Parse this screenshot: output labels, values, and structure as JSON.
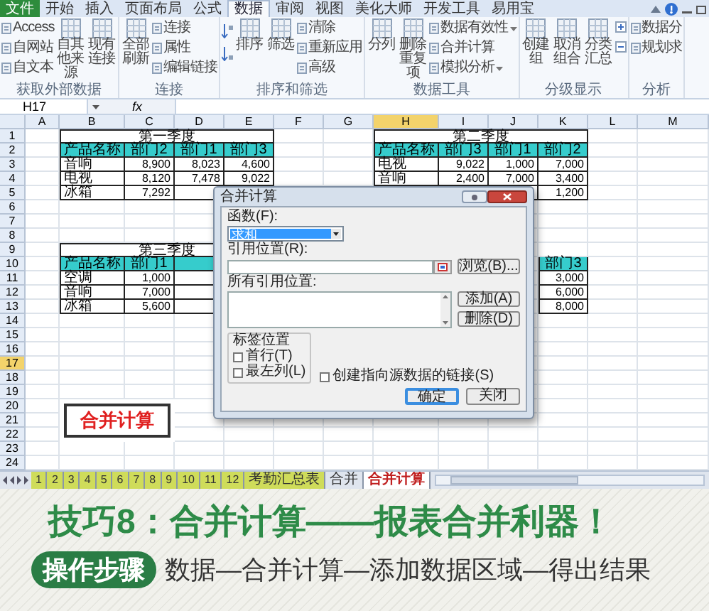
{
  "ribbon_tabs": [
    {
      "label": "文件",
      "kind": "file",
      "selected": false
    },
    {
      "label": "开始",
      "kind": "tab",
      "selected": false
    },
    {
      "label": "插入",
      "kind": "tab",
      "selected": false
    },
    {
      "label": "页面布局",
      "kind": "tab",
      "selected": false
    },
    {
      "label": "公式",
      "kind": "tab",
      "selected": false
    },
    {
      "label": "数据",
      "kind": "tab",
      "selected": true
    },
    {
      "label": "审阅",
      "kind": "tab",
      "selected": false
    },
    {
      "label": "视图",
      "kind": "tab",
      "selected": false
    },
    {
      "label": "美化大师",
      "kind": "tab",
      "selected": false
    },
    {
      "label": "开发工具",
      "kind": "tab",
      "selected": false
    },
    {
      "label": "易用宝",
      "kind": "tab",
      "selected": false
    }
  ],
  "ribbon_groups": [
    {
      "label": "获取外部数据",
      "columns": [
        {
          "kind": "stack",
          "items": [
            {
              "label": "Access"
            },
            {
              "label": "自网站"
            },
            {
              "label": "自文本"
            }
          ]
        },
        {
          "kind": "large",
          "label": "自其他来源"
        },
        {
          "kind": "large",
          "label": "现有连接"
        }
      ]
    },
    {
      "label": "连接",
      "columns": [
        {
          "kind": "large",
          "label": "全部刷新"
        },
        {
          "kind": "stack",
          "items": [
            {
              "label": "连接"
            },
            {
              "label": "属性"
            },
            {
              "label": "编辑链接"
            }
          ]
        }
      ]
    },
    {
      "label": "排序和筛选",
      "columns": [
        {
          "kind": "sort_icons"
        },
        {
          "kind": "large",
          "label": "排序"
        },
        {
          "kind": "large",
          "label": "筛选"
        },
        {
          "kind": "stack",
          "items": [
            {
              "label": "清除"
            },
            {
              "label": "重新应用"
            },
            {
              "label": "高级"
            }
          ]
        }
      ]
    },
    {
      "label": "数据工具",
      "columns": [
        {
          "kind": "large",
          "label": "分列"
        },
        {
          "kind": "large",
          "label": "删除重复项"
        },
        {
          "kind": "stack",
          "items": [
            {
              "label": "数据有效性",
              "has_menu": true
            },
            {
              "label": "合并计算"
            },
            {
              "label": "模拟分析",
              "has_menu": true
            }
          ]
        }
      ]
    },
    {
      "label": "分级显示",
      "columns": [
        {
          "kind": "large",
          "label": "创建组"
        },
        {
          "kind": "large",
          "label": "取消组合"
        },
        {
          "kind": "large",
          "label": "分类汇总"
        },
        {
          "kind": "outline_icons"
        }
      ]
    },
    {
      "label": "分析",
      "columns": [
        {
          "kind": "stack",
          "items": [
            {
              "label": "数据分"
            },
            {
              "label": "规划求"
            }
          ]
        }
      ]
    }
  ],
  "formula_bar": {
    "name_box": "H17",
    "function_button": "fx"
  },
  "sheet": {
    "columns": [
      {
        "label": "A",
        "selected": false
      },
      {
        "label": "B",
        "selected": false
      },
      {
        "label": "C",
        "selected": false
      },
      {
        "label": "D",
        "selected": false
      },
      {
        "label": "E",
        "selected": false
      },
      {
        "label": "F",
        "selected": false
      },
      {
        "label": "G",
        "selected": false
      },
      {
        "label": "H",
        "selected": true
      },
      {
        "label": "I",
        "selected": false
      },
      {
        "label": "J",
        "selected": false
      },
      {
        "label": "K",
        "selected": false
      },
      {
        "label": "L",
        "selected": false
      },
      {
        "label": "M",
        "selected": false
      }
    ],
    "rows": [
      {
        "label": "1",
        "selected": false
      },
      {
        "label": "2",
        "selected": false
      },
      {
        "label": "3",
        "selected": false
      },
      {
        "label": "4",
        "selected": false
      },
      {
        "label": "5",
        "selected": false
      },
      {
        "label": "6",
        "selected": false
      },
      {
        "label": "7",
        "selected": false
      },
      {
        "label": "8",
        "selected": false
      },
      {
        "label": "9",
        "selected": false
      },
      {
        "label": "10",
        "selected": false
      },
      {
        "label": "11",
        "selected": false
      },
      {
        "label": "12",
        "selected": false
      },
      {
        "label": "13",
        "selected": false
      },
      {
        "label": "14",
        "selected": false
      },
      {
        "label": "15",
        "selected": false
      },
      {
        "label": "16",
        "selected": false
      },
      {
        "label": "17",
        "selected": true
      },
      {
        "label": "18",
        "selected": false
      },
      {
        "label": "19",
        "selected": false
      },
      {
        "label": "20",
        "selected": false
      },
      {
        "label": "21",
        "selected": false
      },
      {
        "label": "22",
        "selected": false
      },
      {
        "label": "23",
        "selected": false
      },
      {
        "label": "24",
        "selected": false
      }
    ],
    "tables": [
      {
        "title": "第一季度",
        "header": [
          "产品名称",
          "部门2",
          "部门1",
          "部门3"
        ],
        "rows": [
          [
            "音响",
            "8,900",
            "8,023",
            "4,600"
          ],
          [
            "电视",
            "8,120",
            "7,478",
            "9,022"
          ],
          [
            "冰箱",
            "7,292"
          ]
        ]
      },
      {
        "title": "第二季度",
        "header": [
          "产品名称",
          "部门3",
          "部门1",
          "部门2"
        ],
        "rows": [
          [
            "电视",
            "9,022",
            "1,000",
            "7,000"
          ],
          [
            "音响",
            "2,400",
            "7,000",
            "3,400"
          ],
          [
            "",
            "",
            "",
            "1,200"
          ]
        ]
      },
      {
        "title": "第三季度",
        "header": [
          "产品名称",
          "部门1"
        ],
        "rows": [
          [
            "空调",
            "1,000"
          ],
          [
            "音响",
            "7,000"
          ],
          [
            "冰箱",
            "5,600"
          ]
        ]
      },
      {
        "header": [
          "部门3"
        ],
        "rows": [
          [
            "3,000"
          ],
          [
            "6,000"
          ],
          [
            "8,000"
          ]
        ]
      }
    ],
    "label_box": {
      "text": "合并计算"
    },
    "sheet_tabs": [
      {
        "label": "1",
        "selected": false,
        "color": "#cfdc5a"
      },
      {
        "label": "2",
        "selected": false,
        "color": "#cfdc5a"
      },
      {
        "label": "3",
        "selected": false,
        "color": "#cfdc5a"
      },
      {
        "label": "4",
        "selected": false,
        "color": "#cfdc5a"
      },
      {
        "label": "5",
        "selected": false,
        "color": "#cfdc5a"
      },
      {
        "label": "6",
        "selected": false,
        "color": "#cfdc5a"
      },
      {
        "label": "7",
        "selected": false,
        "color": "#cfdc5a"
      },
      {
        "label": "8",
        "selected": false,
        "color": "#cfdc5a"
      },
      {
        "label": "9",
        "selected": false,
        "color": "#cfdc5a"
      },
      {
        "label": "10",
        "selected": false,
        "color": "#cfdc5a"
      },
      {
        "label": "11",
        "selected": false,
        "color": "#cfdc5a"
      },
      {
        "label": "12",
        "selected": false,
        "color": "#cfdc5a"
      },
      {
        "label": "考勤汇总表",
        "selected": false,
        "color": "#cfdc5a"
      },
      {
        "label": "合并",
        "selected": false
      },
      {
        "label": "合并计算",
        "selected": true
      }
    ]
  },
  "dialog": {
    "title": "合并计算",
    "function_label": "函数(F):",
    "function_value": "求和",
    "reference_label": "引用位置(R):",
    "browse_button": "浏览(B)...",
    "all_references_label": "所有引用位置:",
    "add_button": "添加(A)",
    "delete_button": "删除(D)",
    "label_position": {
      "title": "标签位置",
      "options": [
        {
          "label": "首行(T)",
          "checked": false
        },
        {
          "label": "最左列(L)",
          "checked": false
        }
      ]
    },
    "link_option": {
      "label": "创建指向源数据的链接(S)",
      "checked": false
    },
    "buttons": [
      {
        "label": "确定",
        "default": true
      },
      {
        "label": "关闭",
        "default": false
      }
    ]
  },
  "banner": {
    "title": "技巧8：合并计算——报表合并利器！",
    "step_badge": "操作步骤",
    "steps": "数据—合并计算—添加数据区域—得出结果"
  }
}
